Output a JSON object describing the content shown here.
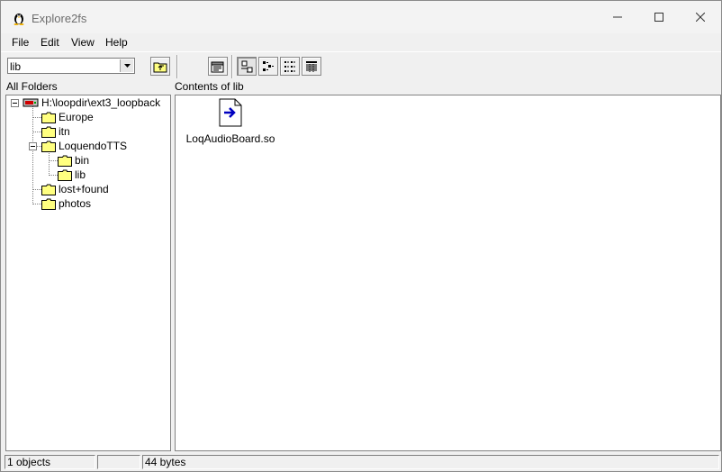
{
  "window": {
    "title": "Explore2fs"
  },
  "menu": [
    "File",
    "Edit",
    "View",
    "Help"
  ],
  "toolbar": {
    "path_value": "lib"
  },
  "left_pane": {
    "header": "All Folders",
    "root": "H:\\loopdir\\ext3_loopback",
    "folders": [
      "Europe",
      "itn",
      "LoquendoTTS",
      "bin",
      "lib",
      "lost+found",
      "photos"
    ]
  },
  "right_pane": {
    "header": "Contents of lib",
    "files": [
      "LoqAudioBoard.so"
    ]
  },
  "status": {
    "objects": "1 objects",
    "middle": "",
    "size": "44 bytes"
  }
}
